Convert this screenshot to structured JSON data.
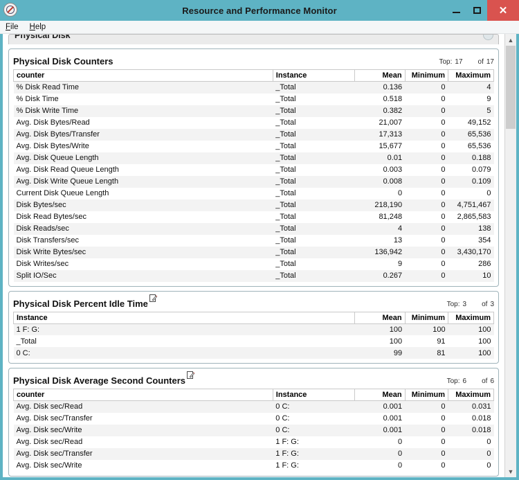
{
  "window": {
    "title": "Resource and Performance Monitor",
    "app_icon": "performance-monitor-icon",
    "minimize_label": "–",
    "maximize_label": "□",
    "close_label": "✕"
  },
  "menu": {
    "items": [
      {
        "label": "File",
        "accel": "F"
      },
      {
        "label": "Help",
        "accel": "H"
      }
    ]
  },
  "collapsed_section": {
    "title": "Physical Disk",
    "chevron": "chevron-up-icon"
  },
  "sections": [
    {
      "title": "Physical Disk Counters",
      "has_edit_icon": false,
      "top_label": "Top:",
      "top_value": "17",
      "of_label": "of",
      "of_value": "17",
      "columns": [
        "counter",
        "Instance",
        "Mean",
        "Minimum",
        "Maximum"
      ],
      "rows": [
        [
          "% Disk Read Time",
          "_Total",
          "0.136",
          "0",
          "4"
        ],
        [
          "% Disk Time",
          "_Total",
          "0.518",
          "0",
          "9"
        ],
        [
          "% Disk Write Time",
          "_Total",
          "0.382",
          "0",
          "5"
        ],
        [
          "Avg. Disk Bytes/Read",
          "_Total",
          "21,007",
          "0",
          "49,152"
        ],
        [
          "Avg. Disk Bytes/Transfer",
          "_Total",
          "17,313",
          "0",
          "65,536"
        ],
        [
          "Avg. Disk Bytes/Write",
          "_Total",
          "15,677",
          "0",
          "65,536"
        ],
        [
          "Avg. Disk Queue Length",
          "_Total",
          "0.01",
          "0",
          "0.188"
        ],
        [
          "Avg. Disk Read Queue Length",
          "_Total",
          "0.003",
          "0",
          "0.079"
        ],
        [
          "Avg. Disk Write Queue Length",
          "_Total",
          "0.008",
          "0",
          "0.109"
        ],
        [
          "Current Disk Queue Length",
          "_Total",
          "0",
          "0",
          "0"
        ],
        [
          "Disk Bytes/sec",
          "_Total",
          "218,190",
          "0",
          "4,751,467"
        ],
        [
          "Disk Read Bytes/sec",
          "_Total",
          "81,248",
          "0",
          "2,865,583"
        ],
        [
          "Disk Reads/sec",
          "_Total",
          "4",
          "0",
          "138"
        ],
        [
          "Disk Transfers/sec",
          "_Total",
          "13",
          "0",
          "354"
        ],
        [
          "Disk Write Bytes/sec",
          "_Total",
          "136,942",
          "0",
          "3,430,170"
        ],
        [
          "Disk Writes/sec",
          "_Total",
          "9",
          "0",
          "286"
        ],
        [
          "Split IO/Sec",
          "_Total",
          "0.267",
          "0",
          "10"
        ]
      ]
    },
    {
      "title": "Physical Disk Percent Idle Time",
      "has_edit_icon": true,
      "top_label": "Top:",
      "top_value": "3",
      "of_label": "of",
      "of_value": "3",
      "columns": [
        "Instance",
        "Mean",
        "Minimum",
        "Maximum"
      ],
      "rows": [
        [
          "1 F: G:",
          "100",
          "100",
          "100"
        ],
        [
          "_Total",
          "100",
          "91",
          "100"
        ],
        [
          "0 C:",
          "99",
          "81",
          "100"
        ]
      ]
    },
    {
      "title": "Physical Disk Average Second Counters",
      "has_edit_icon": true,
      "top_label": "Top:",
      "top_value": "6",
      "of_label": "of",
      "of_value": "6",
      "columns": [
        "counter",
        "Instance",
        "Mean",
        "Minimum",
        "Maximum"
      ],
      "rows": [
        [
          "Avg. Disk sec/Read",
          "0 C:",
          "0.001",
          "0",
          "0.031"
        ],
        [
          "Avg. Disk sec/Transfer",
          "0 C:",
          "0.001",
          "0",
          "0.018"
        ],
        [
          "Avg. Disk sec/Write",
          "0 C:",
          "0.001",
          "0",
          "0.018"
        ],
        [
          "Avg. Disk sec/Read",
          "1 F: G:",
          "0",
          "0",
          "0"
        ],
        [
          "Avg. Disk sec/Transfer",
          "1 F: G:",
          "0",
          "0",
          "0"
        ],
        [
          "Avg. Disk sec/Write",
          "1 F: G:",
          "0",
          "0",
          "0"
        ]
      ]
    }
  ],
  "scrollbar": {
    "up_arrow": "chevron-up-icon",
    "down_arrow": "chevron-down-icon"
  },
  "colors": {
    "titlebar": "#5eb3c4",
    "close_button": "#d9534f",
    "section_border": "#9fb3ba",
    "row_alt": "#f3f3f3"
  }
}
